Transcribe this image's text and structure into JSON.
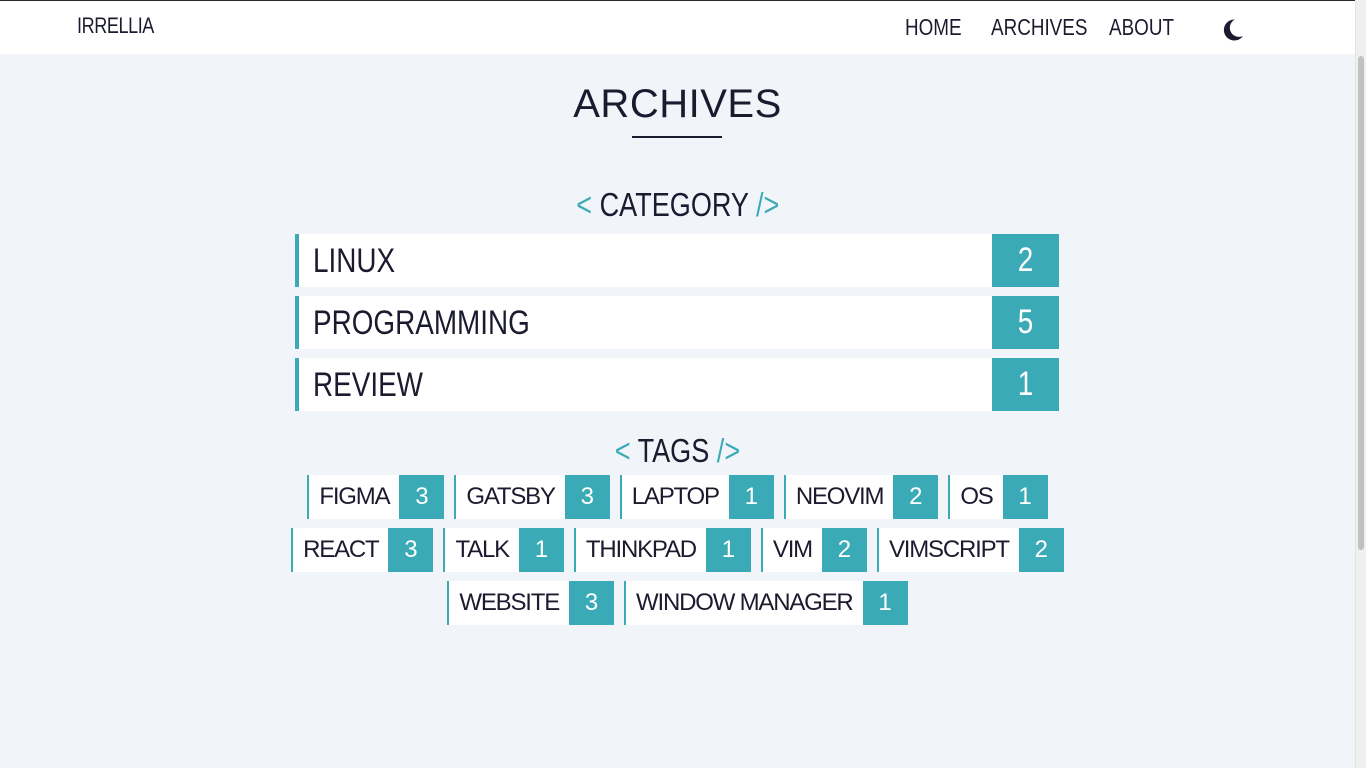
{
  "header": {
    "brand": "IRRELLIA",
    "nav": [
      "HOME",
      "ARCHIVES",
      "ABOUT"
    ],
    "theme_icon": "moon-icon"
  },
  "main": {
    "title": "ARCHIVES",
    "category_heading": {
      "open": "<",
      "label": "CATEGORY",
      "close": "/>"
    },
    "categories": [
      {
        "name": "LINUX",
        "count": "2"
      },
      {
        "name": "PROGRAMMING",
        "count": "5"
      },
      {
        "name": "REVIEW",
        "count": "1"
      }
    ],
    "tags_heading": {
      "open": "<",
      "label": "TAGS",
      "close": "/>"
    },
    "tags": [
      [
        {
          "name": "FIGMA",
          "count": "3"
        },
        {
          "name": "GATSBY",
          "count": "3"
        },
        {
          "name": "LAPTOP",
          "count": "1"
        },
        {
          "name": "NEOVIM",
          "count": "2"
        },
        {
          "name": "OS",
          "count": "1"
        }
      ],
      [
        {
          "name": "REACT",
          "count": "3"
        },
        {
          "name": "TALK",
          "count": "1"
        },
        {
          "name": "THINKPAD",
          "count": "1"
        },
        {
          "name": "VIM",
          "count": "2"
        },
        {
          "name": "VIMSCRIPT",
          "count": "2"
        }
      ],
      [
        {
          "name": "WEBSITE",
          "count": "3"
        },
        {
          "name": "WINDOW MANAGER",
          "count": "1"
        }
      ]
    ]
  },
  "colors": {
    "accent": "#3aabb6",
    "background": "#f1f5fa",
    "text": "#1b1b2f"
  }
}
